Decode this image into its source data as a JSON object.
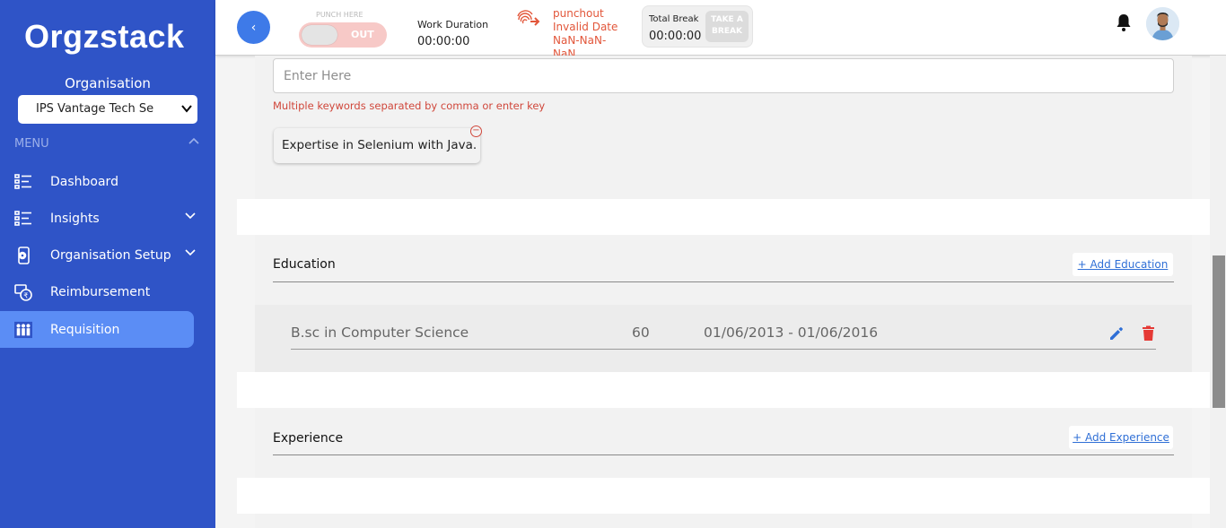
{
  "sidebar": {
    "logo": "Orgzstack",
    "org_label": "Organisation",
    "org_select_value": "IPS Vantage Tech Se",
    "menu_label": "MENU",
    "items": [
      {
        "label": "Dashboard",
        "icon": "list-icon"
      },
      {
        "label": "Insights",
        "icon": "list-icon"
      },
      {
        "label": "Organisation Setup",
        "icon": "phone-gear-icon"
      },
      {
        "label": "Reimbursement",
        "icon": "rupee-refund-icon"
      },
      {
        "label": "Requisition",
        "icon": "people-icon"
      }
    ],
    "active_item": "Requisition"
  },
  "topbar": {
    "back_icon": "‹",
    "punch_label": "PUNCH HERE",
    "punch_toggle_text": "OUT",
    "work_duration_label": "Work Duration",
    "work_duration_value": "00:00:00",
    "punch_status_line1": "punchout",
    "punch_status_line2": "Invalid Date",
    "punch_status_line3": "NaN-NaN-",
    "punch_status_line4": "NaN",
    "total_break_label": "Total Break",
    "total_break_value": "00:00:00",
    "take_break_line1": "TAKE A",
    "take_break_line2": "BREAK"
  },
  "keywords": {
    "placeholder": "Enter Here",
    "hint": "Multiple keywords separated by comma or enter key",
    "chips": [
      "Expertise in Selenium with Java."
    ],
    "chip_remove_symbol": "−"
  },
  "education": {
    "title": "Education",
    "add_label": "+ Add Education",
    "rows": [
      {
        "degree": "B.sc in Computer Science",
        "score": "60",
        "dates": "01/06/2013 - 01/06/2016"
      }
    ]
  },
  "experience": {
    "title": "Experience",
    "add_label": "+ Add Experience"
  },
  "colors": {
    "sidebar_bg": "#2f54c7",
    "active_item_bg": "#5b8df5",
    "accent_blue": "#3e7ae8",
    "error_red": "#d0473b",
    "delete_red": "#e53935"
  }
}
